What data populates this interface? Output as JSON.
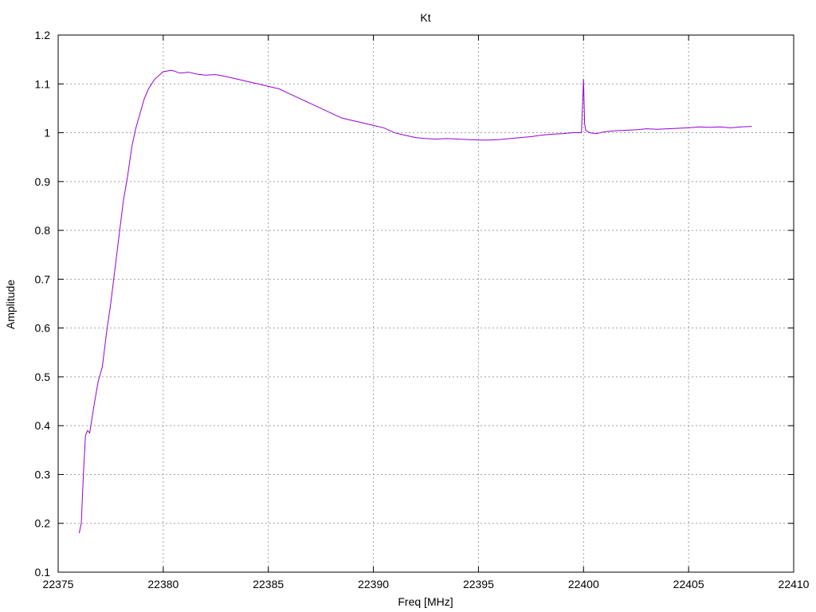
{
  "chart_data": {
    "type": "line",
    "title": "Kt",
    "xlabel": "Freq [MHz]",
    "ylabel": "Amplitude",
    "xlim": [
      22375,
      22410
    ],
    "ylim": [
      0.1,
      1.2
    ],
    "x_ticks": [
      "22375",
      "22380",
      "22385",
      "22390",
      "22395",
      "22400",
      "22405",
      "22410"
    ],
    "y_ticks": [
      "0.1",
      "0.2",
      "0.3",
      "0.4",
      "0.5",
      "0.6",
      "0.7",
      "0.8",
      "0.9",
      "1",
      "1.1",
      "1.2"
    ],
    "grid": true,
    "legend": "none",
    "line_color": "#9400d3",
    "series": [
      {
        "x": [
          22376.0,
          22376.1,
          22376.2,
          22376.3,
          22376.4,
          22376.5,
          22376.7,
          22376.9,
          22377.1,
          22377.3,
          22377.5,
          22377.7,
          22377.9,
          22378.1,
          22378.3,
          22378.5,
          22378.7,
          22378.9,
          22379.1,
          22379.3,
          22379.6,
          22380.0,
          22380.4,
          22380.8,
          22381.2,
          22381.6,
          22382.0,
          22382.5,
          22383.0,
          22383.5,
          22384.0,
          22384.5,
          22385.0,
          22385.5,
          22386.0,
          22386.5,
          22387.0,
          22387.5,
          22388.0,
          22388.5,
          22389.0,
          22389.5,
          22390.0,
          22390.5,
          22391.0,
          22391.5,
          22392.0,
          22392.5,
          22393.0,
          22393.5,
          22394.0,
          22394.5,
          22395.0,
          22395.5,
          22396.0,
          22396.5,
          22397.0,
          22397.5,
          22398.0,
          22398.5,
          22399.0,
          22399.5,
          22399.9,
          22400.0,
          22400.05,
          22400.1,
          22400.3,
          22400.6,
          22401.0,
          22401.5,
          22402.0,
          22402.5,
          22403.0,
          22403.5,
          22404.0,
          22404.5,
          22405.0,
          22405.5,
          22406.0,
          22406.5,
          22407.0,
          22407.5,
          22408.0
        ],
        "y": [
          0.18,
          0.2,
          0.3,
          0.38,
          0.39,
          0.385,
          0.44,
          0.49,
          0.52,
          0.59,
          0.65,
          0.72,
          0.79,
          0.86,
          0.91,
          0.97,
          1.01,
          1.04,
          1.07,
          1.09,
          1.11,
          1.125,
          1.128,
          1.122,
          1.124,
          1.12,
          1.118,
          1.119,
          1.115,
          1.11,
          1.105,
          1.1,
          1.095,
          1.09,
          1.08,
          1.07,
          1.06,
          1.05,
          1.04,
          1.03,
          1.025,
          1.02,
          1.015,
          1.01,
          1.0,
          0.995,
          0.99,
          0.988,
          0.987,
          0.988,
          0.987,
          0.986,
          0.985,
          0.985,
          0.986,
          0.988,
          0.99,
          0.992,
          0.995,
          0.997,
          0.998,
          1.0,
          1.0,
          1.11,
          1.02,
          1.005,
          1.0,
          0.998,
          1.002,
          1.004,
          1.005,
          1.006,
          1.008,
          1.007,
          1.008,
          1.009,
          1.01,
          1.012,
          1.011,
          1.012,
          1.01,
          1.012,
          1.013
        ]
      }
    ]
  }
}
